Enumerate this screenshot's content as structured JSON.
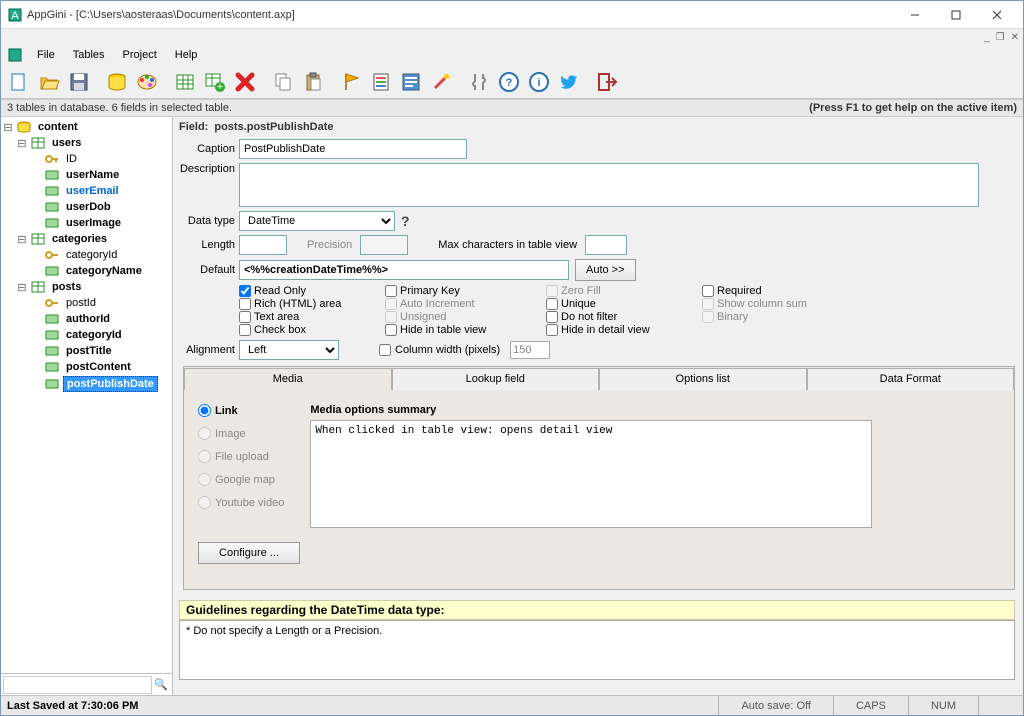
{
  "titlebar": {
    "app": "AppGini",
    "path": "[C:\\Users\\aosteraas\\Documents\\content.axp]"
  },
  "menu": {
    "file": "File",
    "tables": "Tables",
    "project": "Project",
    "help": "Help"
  },
  "statusline": {
    "left": "3 tables in database. 6 fields in selected table.",
    "right": "(Press F1 to get help on the active item)"
  },
  "tree": {
    "root": "content",
    "users": {
      "name": "users",
      "fields": [
        "ID",
        "userName",
        "userEmail",
        "userDob",
        "userImage"
      ]
    },
    "categories": {
      "name": "categories",
      "fields": [
        "categoryId",
        "categoryName"
      ]
    },
    "posts": {
      "name": "posts",
      "fields": [
        "postId",
        "authorId",
        "categoryId",
        "postTitle",
        "postContent",
        "postPublishDate"
      ]
    }
  },
  "field": {
    "heading_prefix": "Field: ",
    "heading": "posts.postPublishDate",
    "caption_label": "Caption",
    "caption": "PostPublishDate",
    "description_label": "Description",
    "description": "",
    "datatype_label": "Data type",
    "datatype": "DateTime",
    "length_label": "Length",
    "precision_label": "Precision",
    "maxchars_label": "Max characters in table view",
    "default_label": "Default",
    "default": "<%%creationDateTime%%>",
    "auto_btn": "Auto >>",
    "cb": {
      "readonly": "Read Only",
      "rich": "Rich (HTML) area",
      "textarea": "Text area",
      "checkbox": "Check box",
      "pk": "Primary Key",
      "autoinc": "Auto Increment",
      "unsigned": "Unsigned",
      "hidetv": "Hide in table view",
      "colwidth": "Column width (pixels)",
      "zerofill": "Zero Fill",
      "unique": "Unique",
      "nofilter": "Do not filter",
      "hidedv": "Hide in detail view",
      "required": "Required",
      "showsum": "Show column sum",
      "binary": "Binary"
    },
    "colwidth_val": "150",
    "alignment_label": "Alignment",
    "alignment": "Left"
  },
  "tabs": {
    "media": "Media",
    "lookup": "Lookup field",
    "options": "Options list",
    "dataformat": "Data Format"
  },
  "media": {
    "link": "Link",
    "image": "Image",
    "upload": "File upload",
    "gmap": "Google map",
    "youtube": "Youtube video",
    "summary_label": "Media options summary",
    "summary": "When clicked in table view: opens detail view",
    "configure": "Configure ..."
  },
  "guidelines": {
    "title": "Guidelines regarding the DateTime data type:",
    "body": "* Do not specify a Length or a Precision."
  },
  "footer": {
    "saved": "Last Saved at 7:30:06 PM",
    "autosave": "Auto save: Off",
    "caps": "CAPS",
    "num": "NUM"
  }
}
